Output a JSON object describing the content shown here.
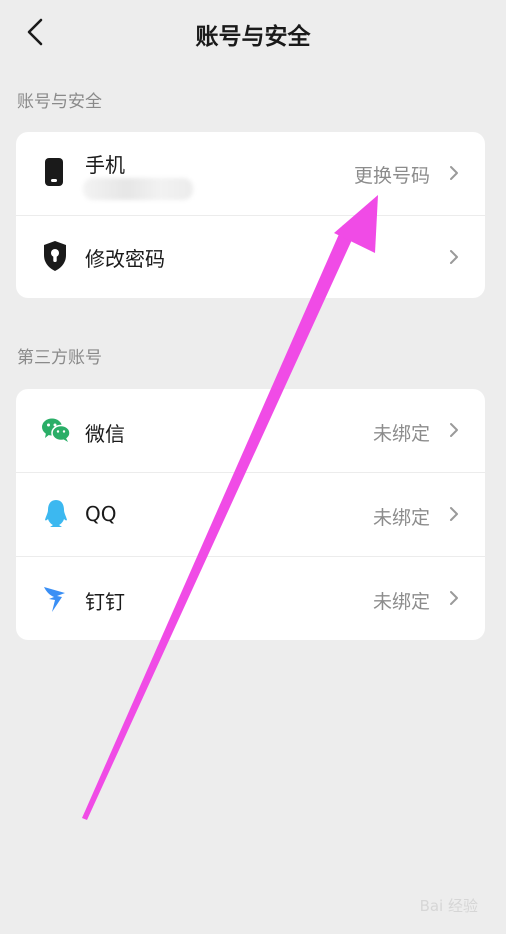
{
  "header": {
    "title": "账号与安全"
  },
  "sections": {
    "account": {
      "label": "账号与安全",
      "phone": {
        "label": "手机",
        "value": "更换号码"
      },
      "password": {
        "label": "修改密码"
      }
    },
    "third_party": {
      "label": "第三方账号",
      "items": [
        {
          "label": "微信",
          "value": "未绑定",
          "icon": "wechat-icon"
        },
        {
          "label": "QQ",
          "value": "未绑定",
          "icon": "qq-icon"
        },
        {
          "label": "钉钉",
          "value": "未绑定",
          "icon": "dingtalk-icon"
        }
      ]
    }
  },
  "watermark": "Bai 经验",
  "colors": {
    "background": "#ededed",
    "card": "#ffffff",
    "annotation_arrow": "#f04be6",
    "wechat": "#2aae67",
    "qq": "#3cb8f0",
    "dingtalk": "#3a8ff5"
  }
}
